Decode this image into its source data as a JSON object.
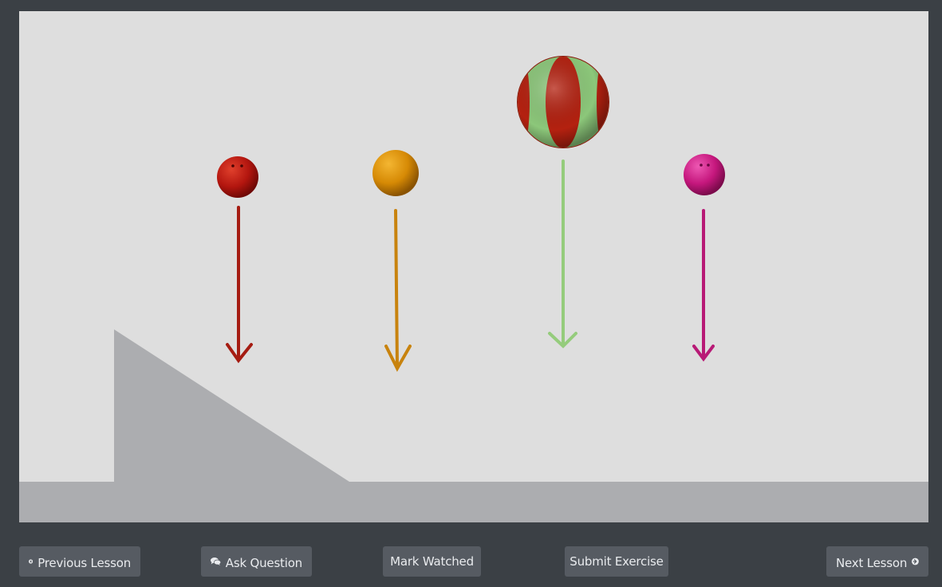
{
  "controls": {
    "previous_label": "Previous Lesson",
    "ask_label": "Ask Question",
    "mark_watched_label": "Mark Watched",
    "submit_label": "Submit Exercise",
    "next_label": "Next Lesson"
  },
  "icons": {
    "previous": "arrow-circle-left-icon",
    "ask": "comments-icon",
    "next": "arrow-circle-right-icon"
  },
  "scene": {
    "balls": [
      {
        "name": "red-bowling-ball",
        "color": "#b3160f"
      },
      {
        "name": "orange-ball",
        "color": "#d68a05"
      },
      {
        "name": "beach-ball",
        "colors": [
          "#8cc77a",
          "#b42110"
        ]
      },
      {
        "name": "magenta-ball",
        "color": "#c5177d"
      }
    ],
    "arrow_colors": [
      "#a51c12",
      "#c8830e",
      "#95cc7c",
      "#b81a76"
    ],
    "ground_color": "#acadb0",
    "background_color": "#dedede"
  }
}
